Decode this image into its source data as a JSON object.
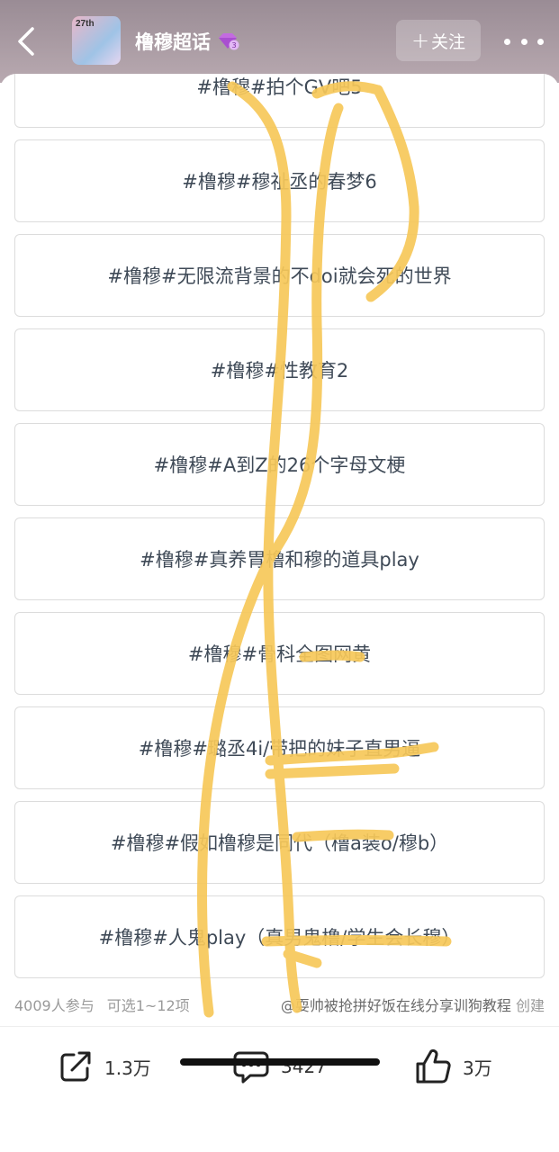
{
  "header": {
    "title": "橹穆超话",
    "avatar_text": "27th",
    "follow_label": "关注",
    "icons": {
      "back": "chevron-left-icon",
      "gem": "gem-level-icon",
      "more": "more-dots-icon"
    }
  },
  "poll": {
    "options": [
      "#橹穆#拍个GV吧5",
      "#橹穆#穆祉丞的春梦6",
      "#橹穆#无限流背景的不doi就会死的世界",
      "#橹穆#性教育2",
      "#橹穆#A到Z的26个字母文梗",
      "#橹穆#真养胃橹和穆的道具play",
      "#橹穆#骨科全图网黄",
      "#橹穆#璐丞4i/带把的妹子直男逼",
      "#橹穆#假如橹穆是同代（橹a装o/穆b）",
      "#橹穆#人鬼play（真男鬼橹/学生会长穆）"
    ],
    "participants": "4009人参与",
    "selectable": "可选1~12项",
    "creator_name": "@耍帅被抢拼好饭在线分享训狗教程",
    "creator_suffix": "创建"
  },
  "actions": {
    "share_count": "1.3万",
    "comment_count": "3427",
    "like_count": "3万",
    "icons": {
      "share": "share-icon",
      "comment": "comment-icon",
      "like": "thumbs-up-icon"
    }
  },
  "colors": {
    "header_bg": "#9a8c95",
    "option_text": "#3f4a57",
    "scribble": "#f7c85a",
    "gem": "#c36be0"
  }
}
